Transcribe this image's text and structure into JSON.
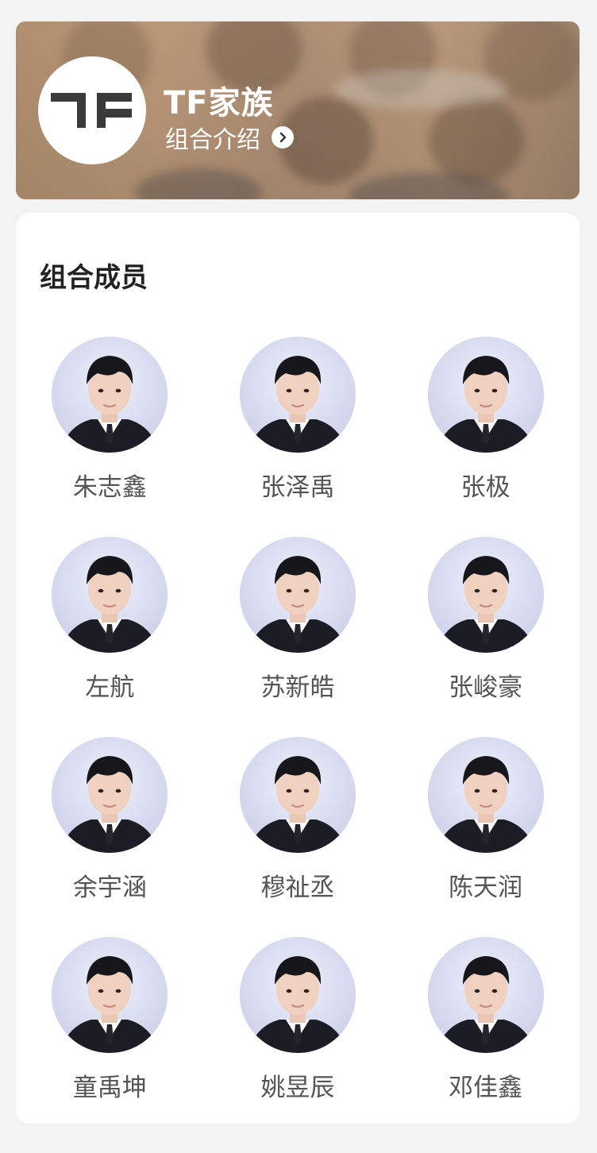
{
  "header": {
    "title": "TF家族",
    "intro_link": "组合介绍",
    "logo_icon": "tf-logo-icon"
  },
  "members_section": {
    "title": "组合成员",
    "members": [
      {
        "name": "朱志鑫",
        "avatar": "portrait-avatar"
      },
      {
        "name": "张泽禹",
        "avatar": "portrait-avatar"
      },
      {
        "name": "张极",
        "avatar": "portrait-avatar"
      },
      {
        "name": "左航",
        "avatar": "portrait-avatar"
      },
      {
        "name": "苏新皓",
        "avatar": "portrait-avatar"
      },
      {
        "name": "张峻豪",
        "avatar": "portrait-avatar"
      },
      {
        "name": "余宇涵",
        "avatar": "portrait-avatar"
      },
      {
        "name": "穆祉丞",
        "avatar": "portrait-avatar"
      },
      {
        "name": "陈天润",
        "avatar": "portrait-avatar"
      },
      {
        "name": "童禹坤",
        "avatar": "portrait-avatar"
      },
      {
        "name": "姚昱辰",
        "avatar": "portrait-avatar"
      },
      {
        "name": "邓佳鑫",
        "avatar": "portrait-avatar"
      }
    ]
  },
  "colors": {
    "page_bg": "#f3f3f3",
    "card_bg": "#ffffff",
    "name_text": "#555555",
    "title_text": "#222222",
    "banner_brown": "#b89674",
    "logo_dark": "#3a3a3a"
  }
}
